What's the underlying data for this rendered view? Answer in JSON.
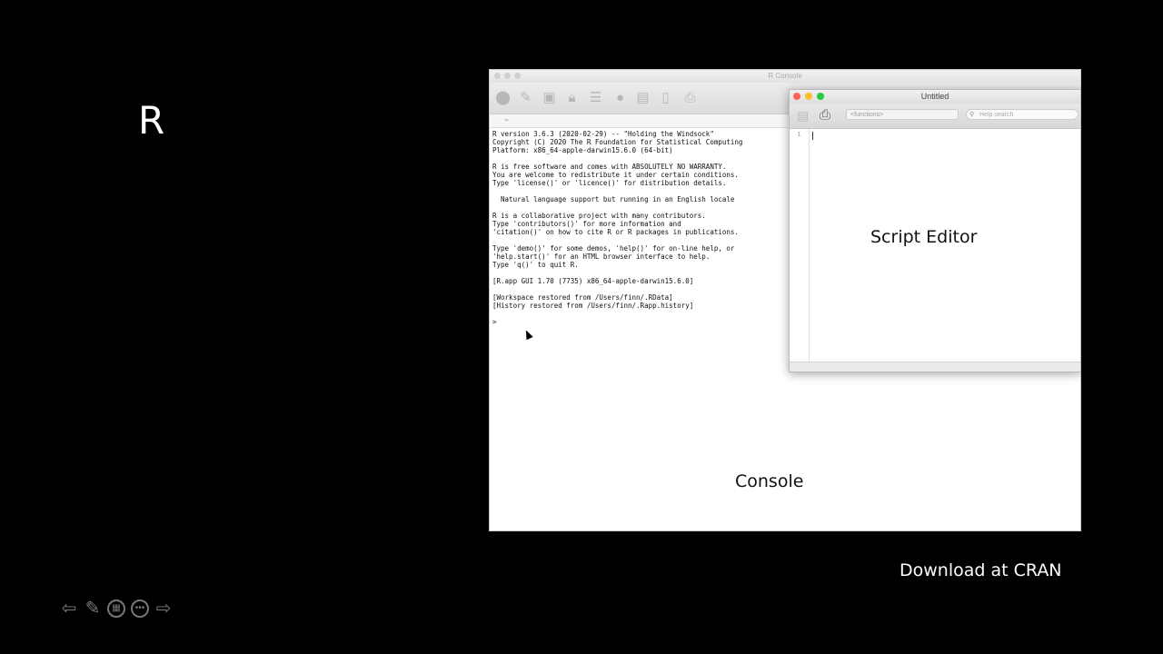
{
  "slide": {
    "title": "R",
    "footer_link": "Download at CRAN"
  },
  "console": {
    "window_title": "R Console",
    "path_text": "~",
    "output_lines": [
      "R version 3.6.3 (2020-02-29) -- \"Holding the Windsock\"",
      "Copyright (C) 2020 The R Foundation for Statistical Computing",
      "Platform: x86_64-apple-darwin15.6.0 (64-bit)",
      "",
      "R is free software and comes with ABSOLUTELY NO WARRANTY.",
      "You are welcome to redistribute it under certain conditions.",
      "Type 'license()' or 'licence()' for distribution details.",
      "",
      "  Natural language support but running in an English locale",
      "",
      "R is a collaborative project with many contributors.",
      "Type 'contributors()' for more information and",
      "'citation()' on how to cite R or R packages in publications.",
      "",
      "Type 'demo()' for some demos, 'help()' for on-line help, or",
      "'help.start()' for an HTML browser interface to help.",
      "Type 'q()' to quit R.",
      "",
      "[R.app GUI 1.70 (7735) x86_64-apple-darwin15.6.0]",
      "",
      "[Workspace restored from /Users/finn/.RData]",
      "[History restored from /Users/finn/.Rapp.history]",
      "",
      ">"
    ],
    "label": "Console"
  },
  "editor": {
    "window_title": "Untitled",
    "functions_placeholder": "<functions>",
    "search_placeholder": "Help search",
    "line_number": "1",
    "label": "Script Editor"
  },
  "icons": {
    "toolbar": [
      "stop-icon",
      "source-icon",
      "image-icon",
      "lock-icon",
      "list-icon",
      "color-icon",
      "new-doc-icon",
      "doc-icon",
      "print-icon"
    ],
    "nav": [
      "back-arrow-icon",
      "pen-icon",
      "slides-icon",
      "more-icon",
      "forward-arrow-icon"
    ]
  }
}
